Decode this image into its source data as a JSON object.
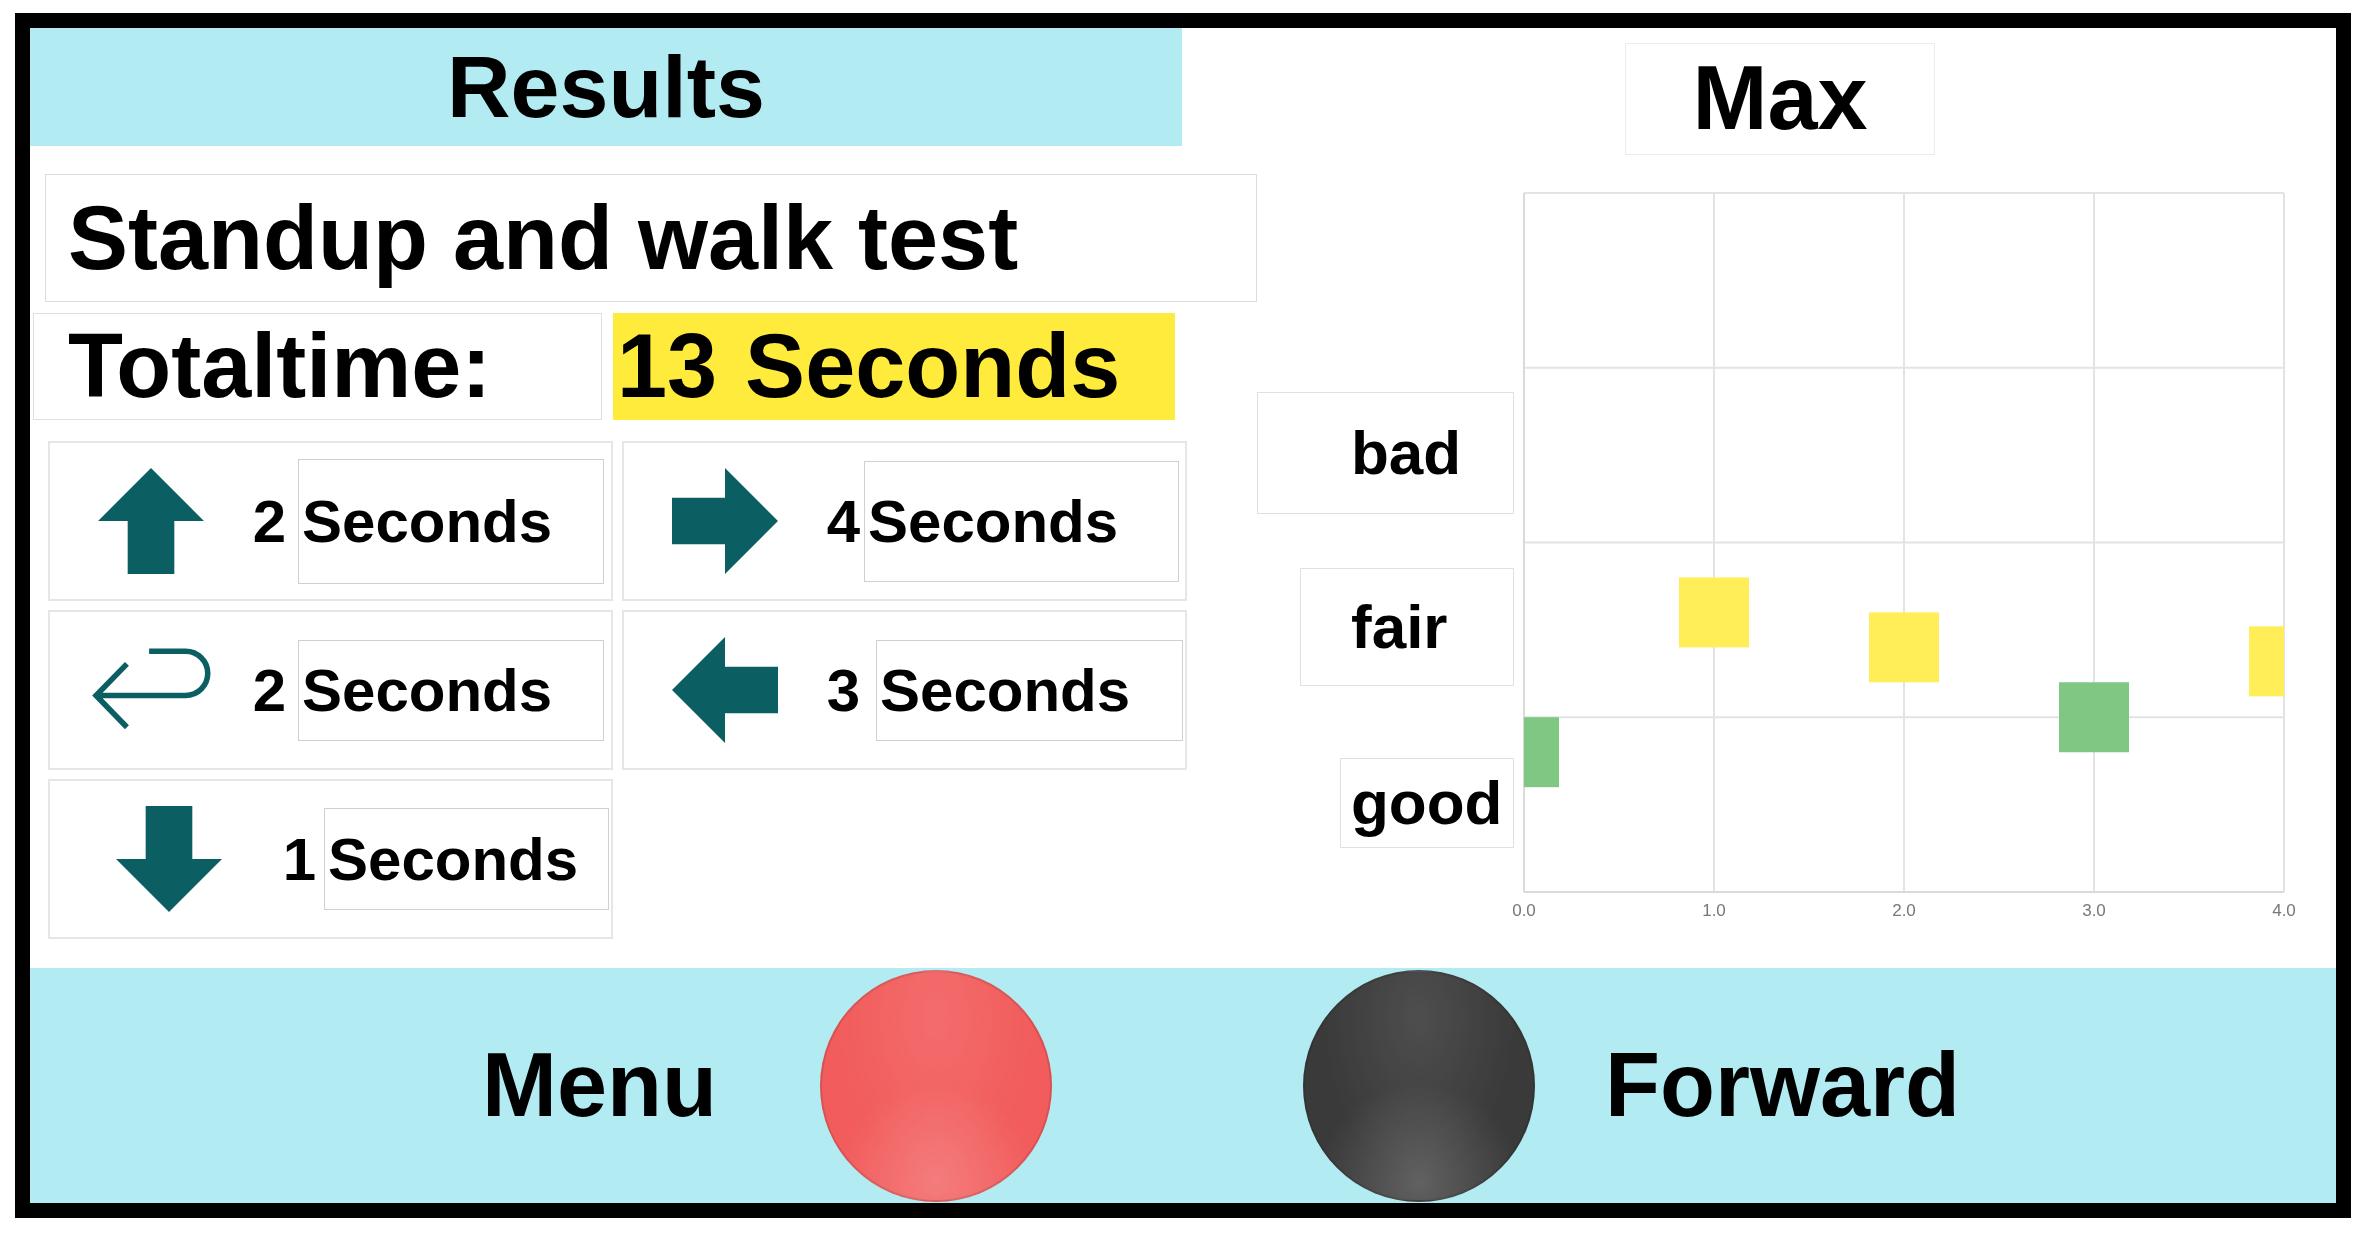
{
  "results_header": {
    "title": "Results"
  },
  "test_name": "Standup and walk test",
  "total_time": {
    "label": "Totaltime:",
    "value": "13",
    "unit": "Seconds"
  },
  "segments": [
    {
      "kind": "up",
      "value": "2",
      "unit": "Seconds"
    },
    {
      "kind": "right",
      "value": "4",
      "unit": "Seconds"
    },
    {
      "kind": "return",
      "value": "2",
      "unit": "Seconds"
    },
    {
      "kind": "left",
      "value": "3",
      "unit": "Seconds"
    },
    {
      "kind": "down",
      "value": "1",
      "unit": "Seconds"
    }
  ],
  "chart_panel": {
    "title": "Max",
    "rating_labels": [
      {
        "label": "bad"
      },
      {
        "label": "fair"
      },
      {
        "label": "good"
      }
    ],
    "x_axis_labels": [
      "0.0",
      "1.0",
      "2.0",
      "3.0",
      "4.0"
    ]
  },
  "bottom_bar": {
    "buttons": [
      {
        "label": "Menu",
        "color": "#f25c5c"
      },
      {
        "label": "Forward",
        "color": "#3a3a3a"
      }
    ]
  }
}
